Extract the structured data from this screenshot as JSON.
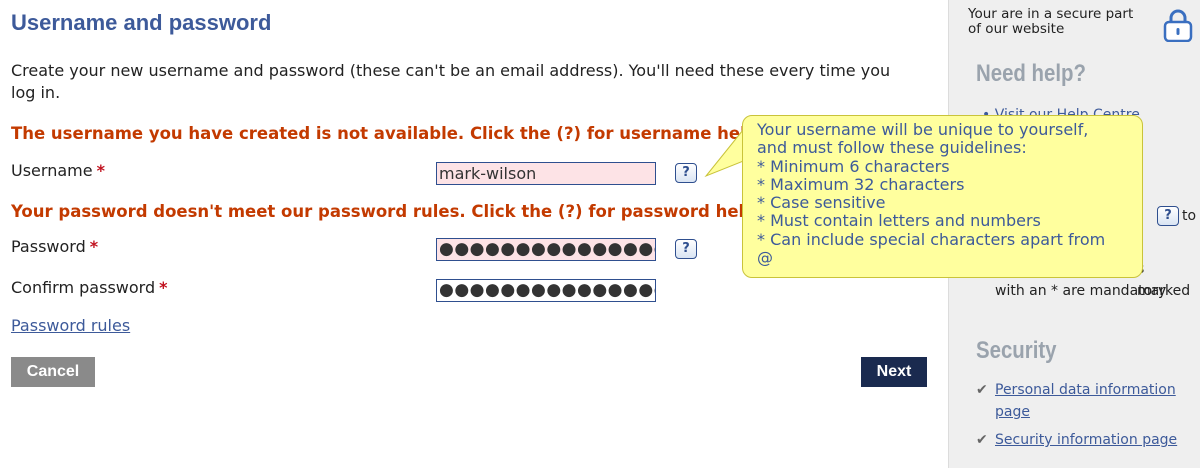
{
  "page": {
    "title": "Username and password",
    "intro": "Create your new username and password (these can't be an email address). You'll need these every time you log in."
  },
  "errors": {
    "username": "The username you have created is not available. Click the (?) for username help",
    "password": "Your password doesn't meet our password rules. Click the (?) for password help"
  },
  "form": {
    "username_label": "Username",
    "username_value": "mark-wilson",
    "password_label": "Password",
    "password_value": "●●●●●●●●●●●●●●●",
    "confirm_label": "Confirm password",
    "confirm_value": "●●●●●●●●●●●●●●●",
    "required_marker": "*",
    "help_button": "?",
    "password_rules_link": "Password rules"
  },
  "buttons": {
    "cancel": "Cancel",
    "next": "Next"
  },
  "tooltip": {
    "lines": [
      "Your username will be unique to yourself,",
      "and must follow these guidelines:",
      "* Minimum 6 characters",
      "* Maximum 32 characters",
      "* Case sensitive",
      "* Must contain letters and numbers",
      "* Can include special characters apart from",
      "@"
    ]
  },
  "sidebar": {
    "secure_text": "Your are in a secure part of our website",
    "need_help_heading": "Need help?",
    "help_visit_partial": "• Visit our Help Centre",
    "help_click_partial": "s",
    "help_click_to": "to",
    "help_fields_marked": "s marked",
    "help_mandatory": "with an * are mandatory",
    "security_heading": "Security",
    "security_links": [
      "Personal data information page",
      "Security information page"
    ]
  },
  "colors": {
    "heading": "#3d5a9a",
    "error": "#c33a00",
    "required": "#c1121f",
    "tooltip_bg": "#ffff9e",
    "next_bg": "#1a2a4f",
    "cancel_bg": "#8a8a8a",
    "sidebar_bg": "#efefef"
  },
  "icons": {
    "lock": "lock-icon",
    "check": "check-icon",
    "help": "question-icon"
  }
}
